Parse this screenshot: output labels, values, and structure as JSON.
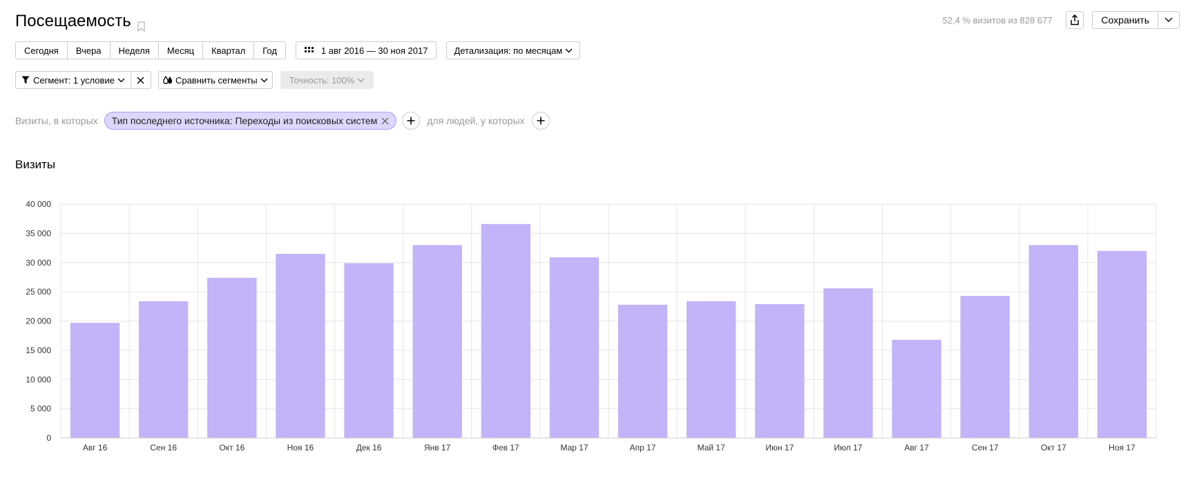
{
  "header": {
    "title": "Посещаемость",
    "visits_info": "52,4 % визитов из 828 677",
    "save_label": "Сохранить"
  },
  "period": {
    "buttons": [
      "Сегодня",
      "Вчера",
      "Неделя",
      "Месяц",
      "Квартал",
      "Год"
    ],
    "date_range": "1 авг 2016 — 30 ноя 2017",
    "detail_label": "Детализация: по месяцам"
  },
  "segment": {
    "label": "Сегмент: 1 условие",
    "compare_label": "Сравнить сегменты",
    "accuracy_label": "Точность: 100%"
  },
  "filter": {
    "visits_label": "Визиты, в которых",
    "chip_label": "Тип последнего источника: Переходы из поисковых систем",
    "people_label": "для людей, у которых"
  },
  "section_title": "Визиты",
  "chart_data": {
    "type": "bar",
    "categories": [
      "Авг 16",
      "Сен 16",
      "Окт 16",
      "Ноя 16",
      "Дек 16",
      "Янв 17",
      "Фев 17",
      "Мар 17",
      "Апр 17",
      "Май 17",
      "Июн 17",
      "Июл 17",
      "Авг 17",
      "Сен 17",
      "Окт 17",
      "Ноя 17"
    ],
    "values": [
      19700,
      23400,
      27400,
      31500,
      29900,
      33000,
      36600,
      30900,
      22800,
      23400,
      22900,
      25600,
      16800,
      24300,
      33000,
      32000
    ],
    "yticks": [
      "0",
      "5 000",
      "10 000",
      "15 000",
      "20 000",
      "25 000",
      "30 000",
      "35 000",
      "40 000"
    ],
    "ylim": [
      0,
      40000
    ],
    "grid": true,
    "bar_color": "#c3b3f8"
  }
}
